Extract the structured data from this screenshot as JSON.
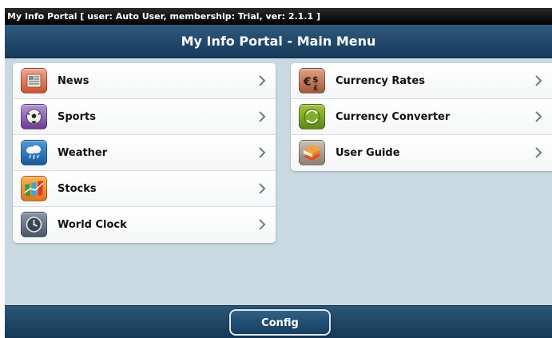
{
  "status_bar": {
    "text": "My Info Portal [ user: Auto User, membership: Trial, ver: 2.1.1 ]"
  },
  "title_bar": {
    "title": "My Info Portal - Main Menu"
  },
  "left_menu": [
    {
      "label": "News",
      "icon": "newspaper-icon"
    },
    {
      "label": "Sports",
      "icon": "soccer-ball-icon"
    },
    {
      "label": "Weather",
      "icon": "rain-cloud-icon"
    },
    {
      "label": "Stocks",
      "icon": "stocks-chart-icon"
    },
    {
      "label": "World Clock",
      "icon": "clock-icon"
    }
  ],
  "right_menu": [
    {
      "label": "Currency Rates",
      "icon": "currency-symbols-icon"
    },
    {
      "label": "Currency Converter",
      "icon": "currency-exchange-icon"
    },
    {
      "label": "User Guide",
      "icon": "book-icon"
    }
  ],
  "bottom_bar": {
    "config_label": "Config"
  },
  "colors": {
    "background": "#c9d9e1",
    "header": "#1f4667",
    "bottom_bar": "#1b4465"
  }
}
